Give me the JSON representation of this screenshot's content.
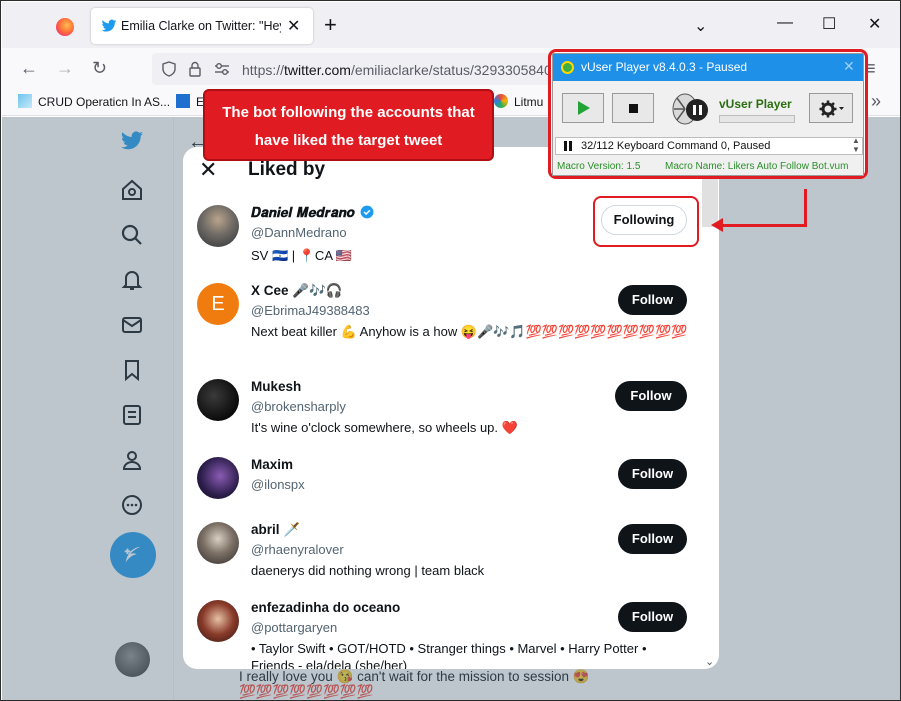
{
  "browser": {
    "tab_title": "Emilia Clarke on Twitter: \"Hey g",
    "tab_close": "✕",
    "new_tab": "+",
    "url_prefix": "https://",
    "url_main": "twitter.com",
    "url_path": "/emiliaclarke/status/3293305840",
    "window_minimize": "—",
    "window_maximize": "☐",
    "window_close": "✕",
    "back": "←",
    "forward": "→",
    "reload": "↻",
    "menu": "≡",
    "bookmarks_overflow": "»",
    "bookmarks": [
      {
        "label": "CRUD Operaticn In AS..."
      },
      {
        "label": "E"
      },
      {
        "label": "Litmu"
      }
    ]
  },
  "callout": {
    "text": "The bot following the accounts that have liked the target tweet"
  },
  "modal": {
    "title": "Liked by",
    "close": "✕",
    "users": [
      {
        "name": "𝑫𝒂𝒏𝒊𝒆𝒍 𝑴𝒆𝒅𝒓𝒂𝒏𝒐",
        "handle": "@DannMedrano",
        "bio": "SV 🇸🇻 | 📍CA 🇺🇸",
        "button": "Following"
      },
      {
        "name": "X Cee 🎤🎶🎧",
        "handle": "@EbrimaJ49388483",
        "bio": "Next beat killer 💪 Anyhow is a how 😝🎤🎶🎵💯💯💯💯💯💯💯💯💯💯",
        "button": "Follow",
        "avatar_letter": "E"
      },
      {
        "name": "Mukesh",
        "handle": "@brokensharply",
        "bio": "It's wine o'clock somewhere, so wheels up. ❤️",
        "button": "Follow"
      },
      {
        "name": "Maxim",
        "handle": "@ilonspx",
        "bio": "",
        "button": "Follow"
      },
      {
        "name": "abril 🗡️",
        "handle": "@rhaenyralover",
        "bio": "daenerys did nothing wrong | team black",
        "button": "Follow"
      },
      {
        "name": "enfezadinha do oceano",
        "handle": "@pottargaryen",
        "bio": "• Taylor Swift • GOT/HOTD • Stranger things • Marvel • Harry Potter • Friends - ela/dela (she/her)",
        "button": "Follow"
      }
    ]
  },
  "background_tweet": "I really love you 😘 can't wait for the mission to session 😍💯💯💯💯💯💯💯💯",
  "vuser": {
    "title": "vUser Player v8.4.0.3 - Paused",
    "close": "✕",
    "logo_text": "vUser Player",
    "status": "32/112 Keyboard Command 0, Paused",
    "macro_version": "Macro Version: 1.5",
    "macro_name": "Macro Name: Likers Auto Follow Bot.vum",
    "progress": 0
  },
  "colors": {
    "twitter_blue": "#1d9bf0",
    "callout_red": "#e01b22",
    "vuser_title_blue": "#1e90e8"
  }
}
